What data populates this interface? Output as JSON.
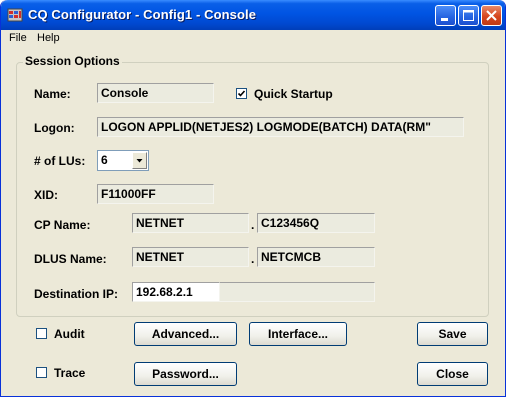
{
  "window": {
    "title": "CQ Configurator - Config1 - Console"
  },
  "menu": {
    "items": [
      "File",
      "Help"
    ]
  },
  "session": {
    "group_label": "Session Options",
    "name_label": "Name:",
    "name_value": "Console",
    "quick_startup_label": "Quick Startup",
    "quick_startup_checked": true,
    "logon_label": "Logon:",
    "logon_value": "LOGON APPLID(NETJES2) LOGMODE(BATCH) DATA(RM\"",
    "lus_label": "# of LUs:",
    "lus_value": "6",
    "xid_label": "XID:",
    "xid_value": "F11000FF",
    "cp_label": "CP Name:",
    "cp_value_1": "NETNET",
    "cp_value_2": "C123456Q",
    "dlus_label": "DLUS Name:",
    "dlus_value_1": "NETNET",
    "dlus_value_2": "NETCMCB",
    "dest_label": "Destination IP:",
    "dest_value": "192.68.2.1",
    "separator": "."
  },
  "options": {
    "audit_label": "Audit",
    "audit_checked": false,
    "trace_label": "Trace",
    "trace_checked": false
  },
  "buttons": {
    "advanced": "Advanced...",
    "interface": "Interface...",
    "password": "Password...",
    "save": "Save",
    "close": "Close"
  }
}
